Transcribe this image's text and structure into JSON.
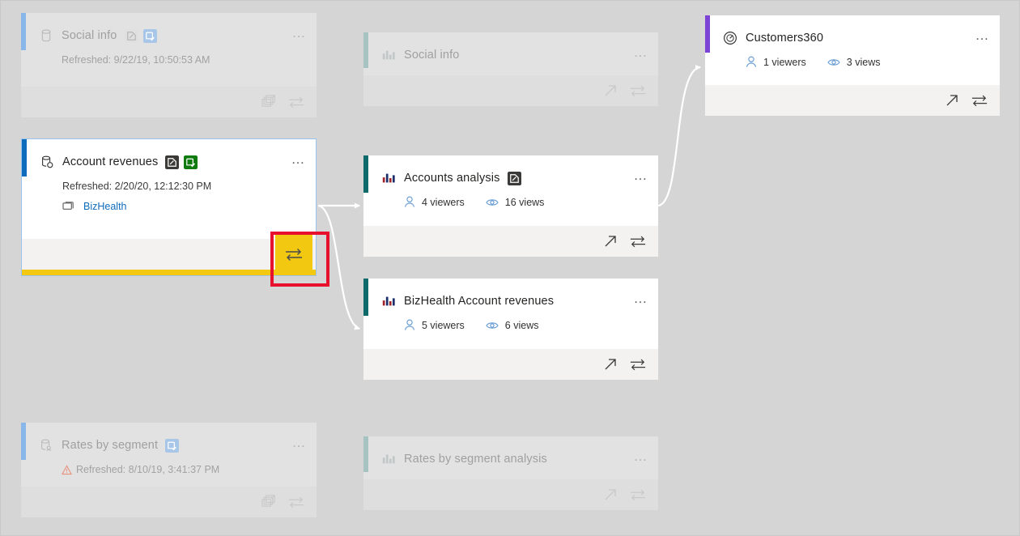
{
  "view": {
    "name": "lineage-view",
    "background_color": "#d5d5d5",
    "highlight_color": "#e8112d",
    "selected_accent_color": "#f2c811"
  },
  "cards": [
    {
      "id": "social-info-dataset",
      "kind": "dataset",
      "title": "Social info",
      "accent_color": "#8ab7e9",
      "state": "faded",
      "meta": "Refreshed: 9/22/19, 10:50:53 AM",
      "has_warning": false,
      "badges": [
        "sensitivity-label-icon",
        "endorsement-certified-icon"
      ],
      "footer_buttons": [
        "create-report-icon",
        "impact-analysis-icon"
      ],
      "menu": "…"
    },
    {
      "id": "account-revenues-dataset",
      "kind": "dataset",
      "title": "Account revenues",
      "accent_color": "#0f6cbd",
      "state": "selected",
      "meta": "Refreshed: 2/20/20, 12:12:30 PM",
      "has_warning": false,
      "badges": [
        "sensitivity-label-icon",
        "endorsement-certified-icon"
      ],
      "workspace": "BizHealth",
      "footer_buttons": [
        "impact-analysis-icon"
      ],
      "menu": "…"
    },
    {
      "id": "rates-by-segment-dataset",
      "kind": "dataset",
      "title": "Rates by segment",
      "accent_color": "#8ab7e9",
      "state": "faded",
      "meta": "Refreshed: 8/10/19, 3:41:37 PM",
      "has_warning": true,
      "badges": [
        "sensitivity-label-icon"
      ],
      "footer_buttons": [
        "create-report-icon",
        "impact-analysis-icon"
      ],
      "menu": "…"
    },
    {
      "id": "social-info-report",
      "kind": "report",
      "title": "Social info",
      "accent_color": "#a6c3c2",
      "state": "faded",
      "footer_buttons": [
        "open-report-icon",
        "impact-analysis-icon"
      ],
      "menu": "…"
    },
    {
      "id": "accounts-analysis-report",
      "kind": "report",
      "title": "Accounts analysis",
      "accent_color": "#0d6a6a",
      "state": "normal",
      "badges": [
        "sensitivity-label-icon"
      ],
      "viewers": "4 viewers",
      "views": "16 views",
      "footer_buttons": [
        "open-report-icon",
        "impact-analysis-icon"
      ],
      "menu": "…"
    },
    {
      "id": "bizhealth-account-revenues-report",
      "kind": "report",
      "title": "BizHealth Account revenues",
      "accent_color": "#0d6a6a",
      "state": "normal",
      "badges": [],
      "viewers": "5 viewers",
      "views": "6 views",
      "footer_buttons": [
        "open-report-icon",
        "impact-analysis-icon"
      ],
      "menu": "…"
    },
    {
      "id": "rates-by-segment-analysis-report",
      "kind": "report",
      "title": "Rates by segment analysis",
      "accent_color": "#a6c3c2",
      "state": "faded",
      "footer_buttons": [
        "open-report-icon",
        "impact-analysis-icon"
      ],
      "menu": "…"
    },
    {
      "id": "customers360-dashboard",
      "kind": "dashboard",
      "title": "Customers360",
      "accent_color": "#7d43d4",
      "state": "normal",
      "viewers": "1 viewers",
      "views": "3 views",
      "footer_buttons": [
        "open-dashboard-icon",
        "impact-analysis-icon"
      ],
      "menu": "…"
    }
  ]
}
